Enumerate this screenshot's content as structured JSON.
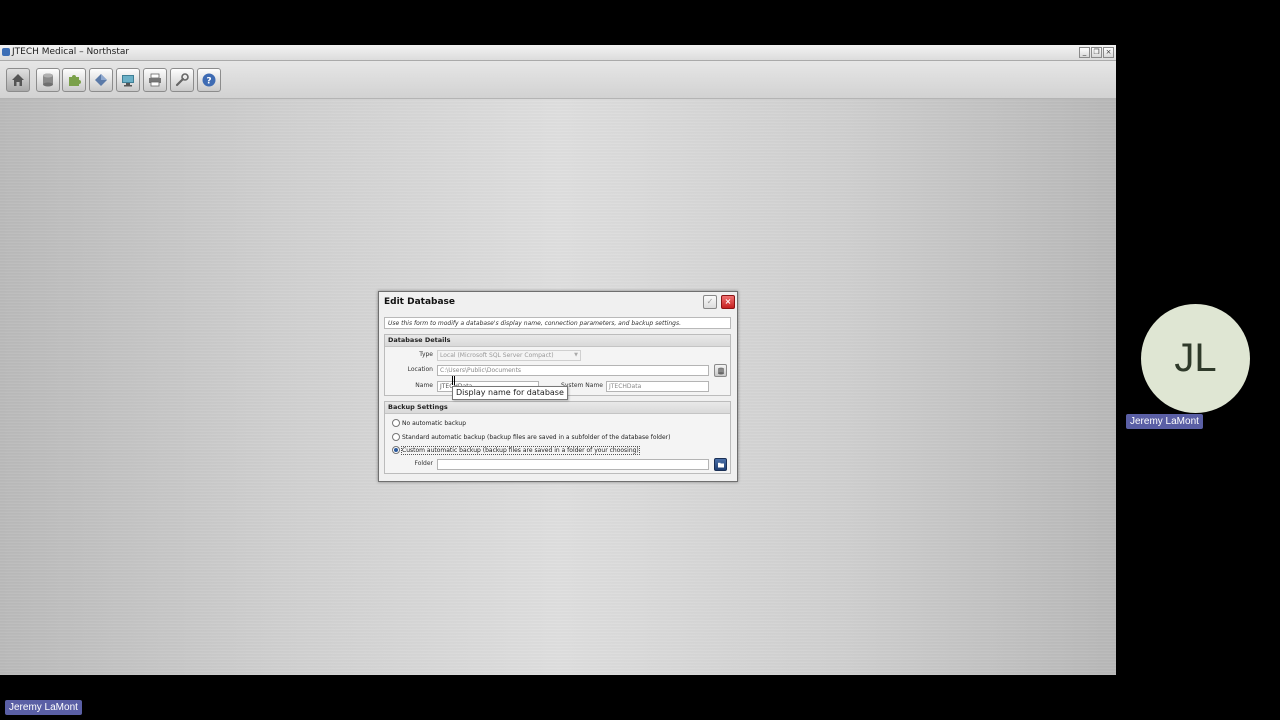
{
  "window": {
    "title": "JTECH Medical – Northstar",
    "controls": [
      "minimize",
      "restore",
      "close"
    ]
  },
  "toolbar": {
    "buttons": [
      {
        "icon": "home-icon",
        "tooltip": ""
      },
      {
        "icon": "database-icon",
        "tooltip": ""
      },
      {
        "icon": "puzzle-icon",
        "tooltip": ""
      },
      {
        "icon": "diamond-icon",
        "tooltip": ""
      },
      {
        "icon": "monitor-icon",
        "tooltip": ""
      },
      {
        "icon": "printer-icon",
        "tooltip": ""
      },
      {
        "icon": "wrench-icon",
        "tooltip": ""
      },
      {
        "icon": "help-icon",
        "tooltip": ""
      }
    ]
  },
  "dialog": {
    "title": "Edit Database",
    "description": "Use this form to modify a database's display name, connection parameters, and backup settings.",
    "details": {
      "heading": "Database Details",
      "type_label": "Type",
      "type_value": "Local (Microsoft SQL Server Compact)",
      "location_label": "Location",
      "location_value": "C:\\Users\\Public\\Documents",
      "name_label": "Name",
      "name_value": "JTECHData",
      "system_name_label": "System Name",
      "system_name_value": "JTECHData"
    },
    "backup": {
      "heading": "Backup Settings",
      "option_none": "No automatic backup",
      "option_standard": "Standard automatic backup (backup files are saved in a subfolder of the database folder)",
      "option_custom": "Custom automatic backup (backup files are saved in a folder of your choosing)",
      "selected": "custom",
      "folder_label": "Folder",
      "folder_value": ""
    },
    "tooltip": "Display name for database"
  },
  "call": {
    "initials": "JL",
    "participant_name": "Jeremy LaMont",
    "presenter_name": "Jeremy LaMont"
  },
  "colors": {
    "accent": "#5a5fa5",
    "close": "#c52020",
    "avatar_bg": "#dfe6d3"
  }
}
